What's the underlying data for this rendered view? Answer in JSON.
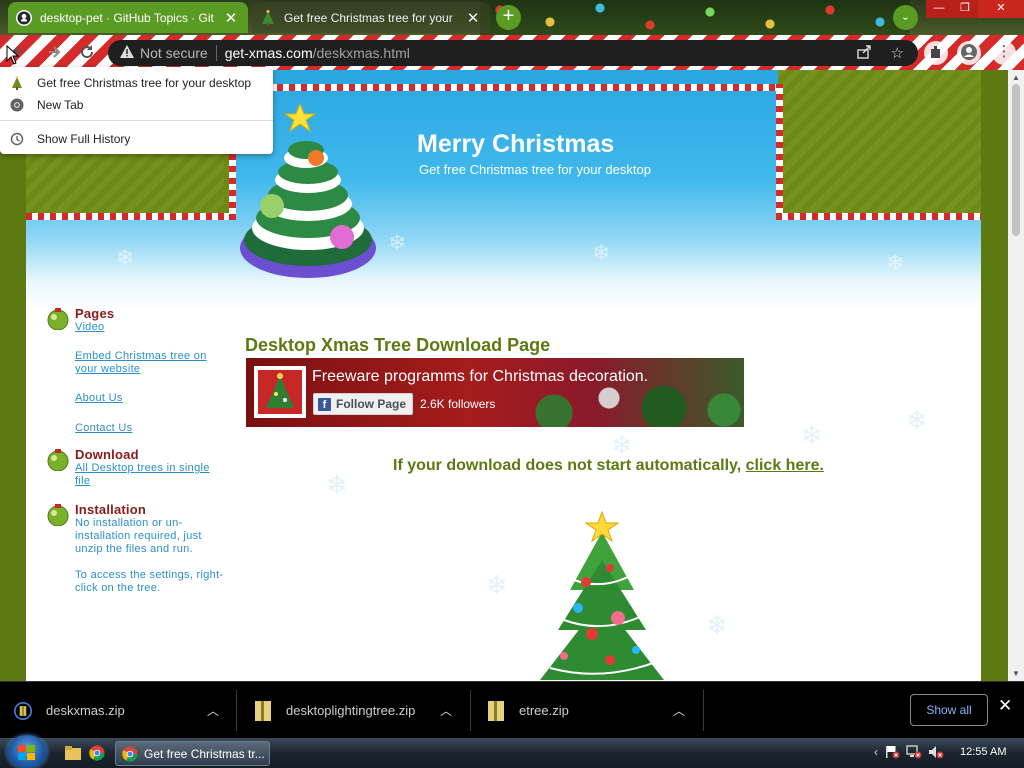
{
  "browser": {
    "tabs": [
      {
        "title": "desktop-pet · GitHub Topics · Git",
        "icon": "github-icon",
        "active": true
      },
      {
        "title": "Get free Christmas tree for your",
        "icon": "xmas-tree-favicon",
        "active": false
      }
    ],
    "new_tab_label": "+",
    "tab_search_label": "⌄",
    "window_controls": {
      "minimize": "—",
      "maximize": "❐",
      "close": "✕"
    },
    "address": {
      "security_label": "Not secure",
      "host": "get-xmas.com",
      "path": "/deskxmas.html"
    },
    "colors": {
      "tab_active": "#5a9b23",
      "omnibox": "#1f1f1f",
      "theme_red": "#d42a2a"
    }
  },
  "history_menu": {
    "items": [
      {
        "label": "Get free Christmas tree for your desktop",
        "icon": "xmas-tree-favicon"
      },
      {
        "label": "New Tab",
        "icon": "chrome-icon"
      }
    ],
    "show_full_history": "Show Full History"
  },
  "site": {
    "title": "Merry Christmas",
    "subtitle": "Get free Christmas tree for your desktop",
    "colors": {
      "heading_green": "#5d7a12",
      "section_red": "#8b1a1a",
      "link_blue": "#2a8fc9",
      "sky_blue": "#2aa6e0"
    }
  },
  "sidebar": {
    "pages": {
      "title": "Pages",
      "links": [
        "Video",
        "Embed Christmas tree on your website",
        "About Us",
        "Contact Us"
      ]
    },
    "download": {
      "title": "Download",
      "link": "All Desktop trees in single file"
    },
    "installation": {
      "title": "Installation",
      "text1": "No installation or un-installation required, just unzip the files and run.",
      "text2": "To access the settings, right-click on the tree."
    }
  },
  "main": {
    "heading": "Desktop Xmas Tree Download Page",
    "fb": {
      "page_name": "Freeware programms for Christmas decoration.",
      "follow_label": "Follow Page",
      "followers": "2.6K followers"
    },
    "download_prefix": "If your download does not start automatically, ",
    "download_link": "click here."
  },
  "downloads": {
    "items": [
      {
        "name": "deskxmas.zip",
        "icon": "zip-file-icon"
      },
      {
        "name": "desktoplightingtree.zip",
        "icon": "zip-file-icon"
      },
      {
        "name": "etree.zip",
        "icon": "zip-file-icon"
      }
    ],
    "show_all": "Show all",
    "close": "✕"
  },
  "taskbar": {
    "active_window": "Get free Christmas tr...",
    "clock": "12:55 AM",
    "tray_arrow": "‹"
  }
}
